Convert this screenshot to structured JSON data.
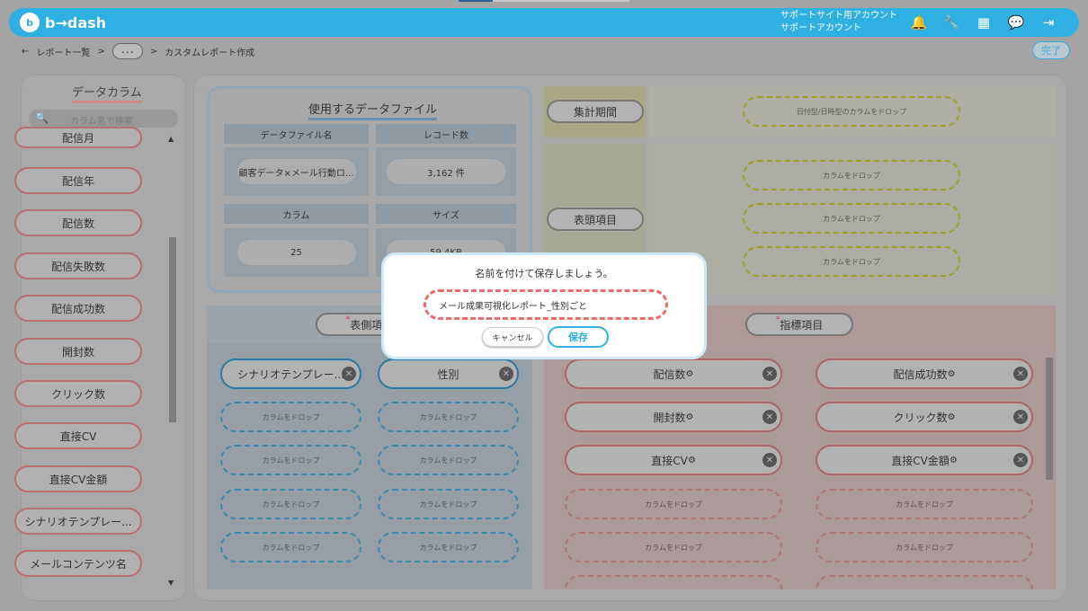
{
  "app": {
    "brand_mark": "b",
    "brand_name": "b→dash"
  },
  "header": {
    "account_line1": "サポートサイト用アカウント",
    "account_line2": "サポートアカウント",
    "icons": [
      "bell-icon",
      "wrench-icon",
      "grid-icon",
      "chat-icon",
      "logout-icon"
    ]
  },
  "breadcrumb": {
    "back": "←",
    "item1": "レポート一覧",
    "sep": ">",
    "more": "･･･",
    "current": "カスタムレポート作成"
  },
  "done_label": "完了",
  "sidebar": {
    "title": "データカラム",
    "search_placeholder": "カラム名で検索",
    "items": [
      "配信月",
      "配信年",
      "配信数",
      "配信失敗数",
      "配信成功数",
      "開封数",
      "クリック数",
      "直接CV",
      "直接CV金額",
      "シナリオテンプレー...",
      "メールコンテンツ名"
    ]
  },
  "data_file": {
    "title": "使用するデータファイル",
    "h_filename": "データファイル名",
    "h_records": "レコード数",
    "v_filename": "顧客データ×メール行動ロ...",
    "v_records": "3,162 件",
    "h_columns": "カラム",
    "h_size": "サイズ",
    "v_columns": "25",
    "v_size": "59.4KB"
  },
  "period": {
    "label": "集計期間",
    "drop": "日付型/日時型のカラムをドロップ"
  },
  "head_items": {
    "label": "表頭項目",
    "drops": [
      "カラムをドロップ",
      "カラムをドロップ",
      "カラムをドロップ"
    ]
  },
  "side_items": {
    "label": "表側項目",
    "chips": [
      "シナリオテンプレー...",
      "性別"
    ],
    "drop": "カラムをドロップ"
  },
  "metrics": {
    "label": "指標項目",
    "chips": [
      "配信数",
      "配信成功数",
      "開封数",
      "クリック数",
      "直接CV",
      "直接CV金額"
    ],
    "drop": "カラムをドロップ"
  },
  "dialog": {
    "title": "名前を付けて保存しましょう。",
    "input_value": "メール成果可視化レポート_性別ごと",
    "cancel": "キャンセル",
    "save": "保存"
  }
}
